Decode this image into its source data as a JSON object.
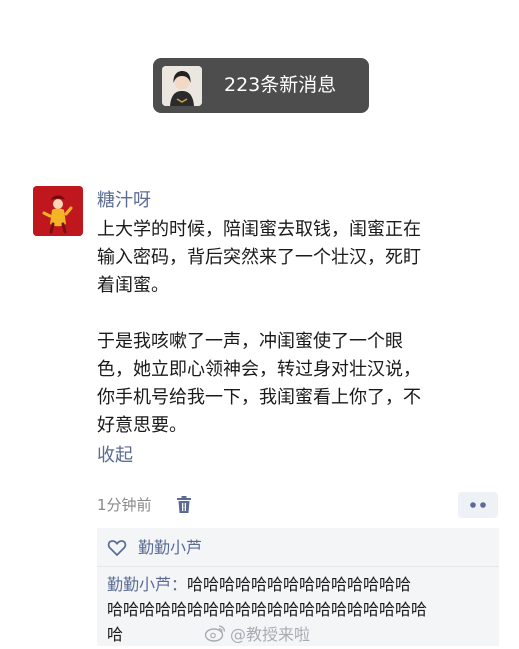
{
  "notification": {
    "text": "223条新消息",
    "avatar_icon": "person-avatar-icon"
  },
  "post": {
    "username": "糖汁呀",
    "avatar_icon": "character-avatar-icon",
    "lines": [
      "上大学的时候，陪闺蜜去取钱，闺蜜正在",
      "输入密码，背后突然来了一个壮汉，死盯",
      "着闺蜜。",
      "于是我咳嗽了一声，冲闺蜜使了一个眼",
      "色，她立即心领神会，转过身对壮汉说，",
      "你手机号给我一下，我闺蜜看上你了，不",
      "好意思要。"
    ],
    "collapse_label": "收起",
    "time": "1分钟前"
  },
  "likes": {
    "name": "勤勤小芦"
  },
  "comment": {
    "author": "勤勤小芦：",
    "line1": "哈哈哈哈哈哈哈哈哈哈哈哈哈哈",
    "line2": "哈哈哈哈哈哈哈哈哈哈哈哈哈哈哈哈哈哈哈哈",
    "line3": "哈"
  },
  "watermark": {
    "text": "@教授来啦"
  },
  "colors": {
    "link": "#5b6c94",
    "pill_bg": "#4d4d4d",
    "comment_bg": "#f4f5f7",
    "avatar_bg": "#c0171f"
  }
}
